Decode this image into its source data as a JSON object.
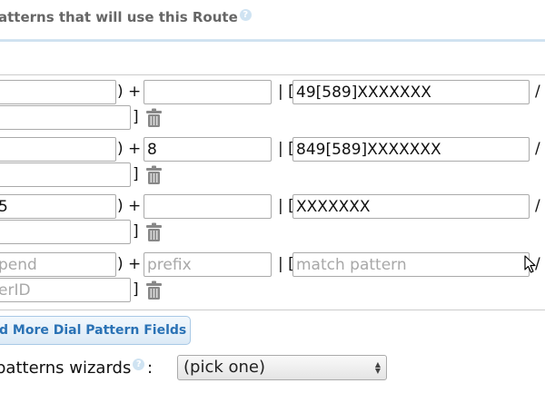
{
  "section": {
    "title": "atterns that will use this Route",
    "help": "?"
  },
  "rows": [
    {
      "prepend": {
        "value": "",
        "placeholder": ""
      },
      "plus": ") +",
      "prefix": {
        "value": "",
        "placeholder": ""
      },
      "bar": "| [",
      "match": {
        "value": "49[589]XXXXXXX",
        "placeholder": ""
      },
      "slash": "/",
      "callerid": {
        "value": "",
        "placeholder": ""
      },
      "close": "]"
    },
    {
      "prepend": {
        "value": "",
        "placeholder": ""
      },
      "plus": ") +",
      "prefix": {
        "value": "8",
        "placeholder": ""
      },
      "bar": "| [",
      "match": {
        "value": "849[589]XXXXXXX",
        "placeholder": ""
      },
      "slash": "/",
      "callerid": {
        "value": "",
        "placeholder": ""
      },
      "close": "]"
    },
    {
      "prepend": {
        "value": "5",
        "placeholder": ""
      },
      "plus": ") +",
      "prefix": {
        "value": "",
        "placeholder": ""
      },
      "bar": "| [",
      "match": {
        "value": "XXXXXXX",
        "placeholder": ""
      },
      "slash": "/",
      "callerid": {
        "value": "",
        "placeholder": ""
      },
      "close": "]"
    },
    {
      "prepend": {
        "value": "",
        "placeholder": "pend"
      },
      "plus": ") +",
      "prefix": {
        "value": "",
        "placeholder": "prefix"
      },
      "bar": "| [",
      "match": {
        "value": "",
        "placeholder": "match pattern"
      },
      "slash": "/",
      "callerid": {
        "value": "",
        "placeholder": "erID"
      },
      "close": "]"
    }
  ],
  "add_button": {
    "label": "dd More Dial Pattern Fields"
  },
  "wizard": {
    "label": "patterns wizards",
    "help": "?",
    "colon": ":",
    "selected": "(pick one)"
  },
  "icons": {
    "trash": "trash-icon",
    "help": "help-icon",
    "cursor": "mouse-pointer-icon",
    "select_arrows": "up-down-arrows-icon"
  },
  "colors": {
    "accent": "#2a72b5",
    "title_text": "#666666",
    "placeholder": "#a8a8a8"
  }
}
